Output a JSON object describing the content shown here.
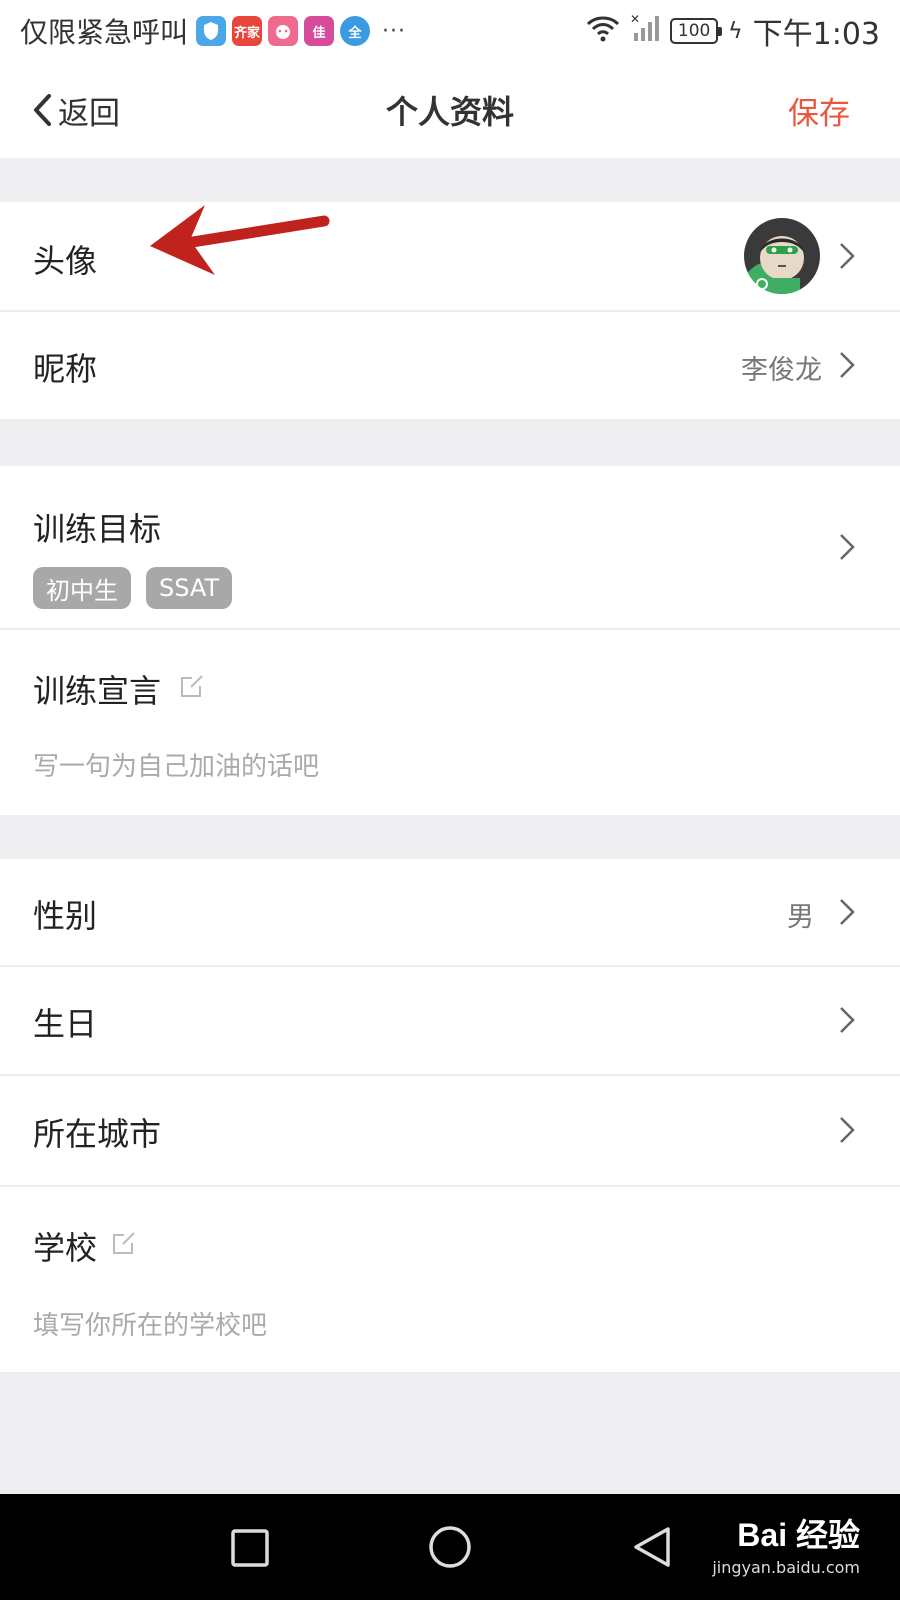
{
  "status_bar": {
    "carrier": "仅限紧急呼叫",
    "app_icons": [
      {
        "name": "shield-app-icon",
        "color": "#4aa8e8",
        "text": ""
      },
      {
        "name": "qijia-app-icon",
        "color": "#e8453c",
        "text": "齐家"
      },
      {
        "name": "pink-app-icon",
        "color": "#f06a8e",
        "text": ""
      },
      {
        "name": "jia-app-icon",
        "color": "#d74b9c",
        "text": "佳"
      },
      {
        "name": "quan-app-icon",
        "color": "#3b9be0",
        "text": "全"
      }
    ],
    "more": "···",
    "battery": "100",
    "time": "下午1:03"
  },
  "navbar": {
    "back_label": "返回",
    "title": "个人资料",
    "save_label": "保存"
  },
  "profile": {
    "avatar_label": "头像",
    "nickname_label": "昵称",
    "nickname_value": "李俊龙",
    "goal_label": "训练目标",
    "goal_tags": [
      "初中生",
      "SSAT"
    ],
    "declaration_label": "训练宣言",
    "declaration_placeholder": "写一句为自己加油的话吧",
    "gender_label": "性别",
    "gender_value": "男",
    "birthday_label": "生日",
    "city_label": "所在城市",
    "school_label": "学校",
    "school_placeholder": "填写你所在的学校吧"
  },
  "watermark": {
    "logo": "Bai 经验",
    "url": "jingyan.baidu.com"
  },
  "colors": {
    "accent": "#e8573e",
    "tag_bg": "#a8a8ab",
    "annotation_arrow": "#c0231e"
  }
}
